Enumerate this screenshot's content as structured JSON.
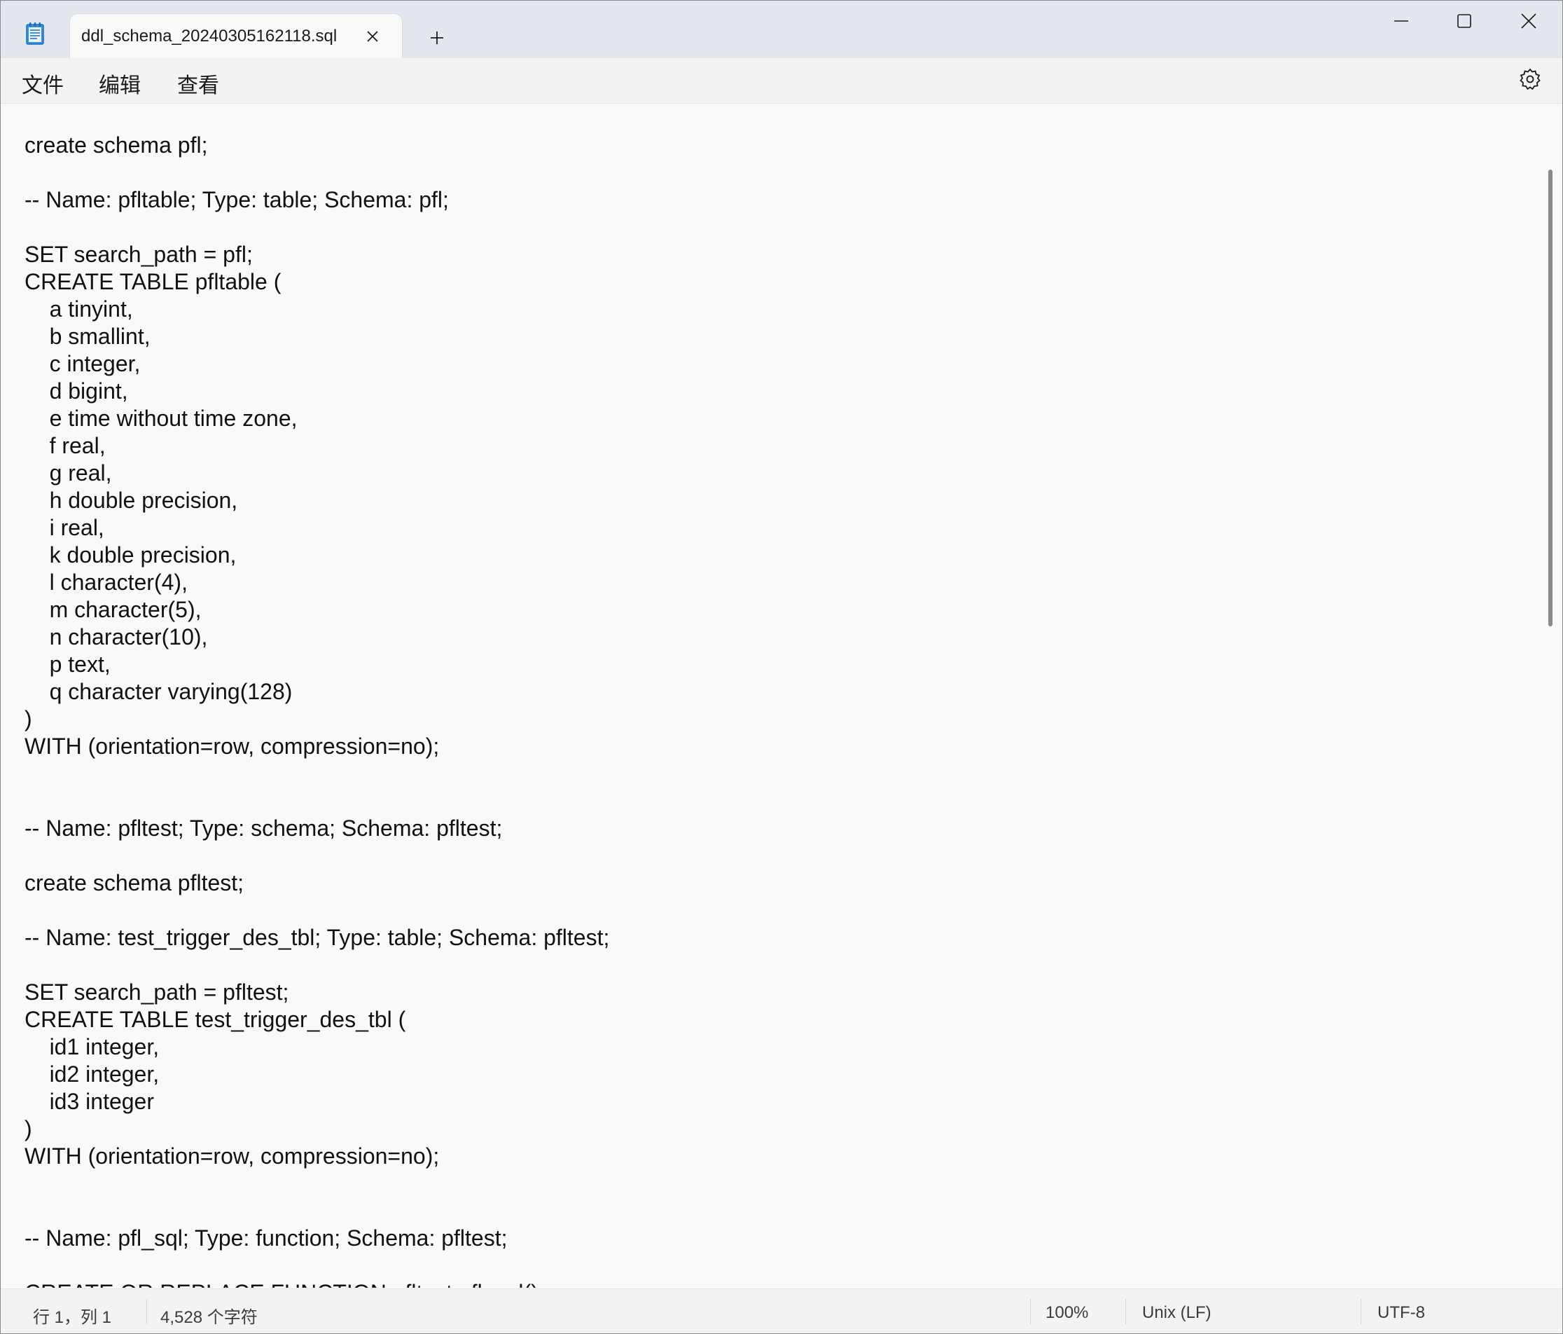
{
  "tab": {
    "title": "ddl_schema_20240305162118.sql"
  },
  "menu": {
    "file": "文件",
    "edit": "编辑",
    "view": "查看"
  },
  "editor": {
    "content": "create schema pfl;\n\n-- Name: pfltable; Type: table; Schema: pfl;\n\nSET search_path = pfl;\nCREATE TABLE pfltable (\n    a tinyint,\n    b smallint,\n    c integer,\n    d bigint,\n    e time without time zone,\n    f real,\n    g real,\n    h double precision,\n    i real,\n    k double precision,\n    l character(4),\n    m character(5),\n    n character(10),\n    p text,\n    q character varying(128)\n)\nWITH (orientation=row, compression=no);\n\n\n-- Name: pfltest; Type: schema; Schema: pfltest;\n\ncreate schema pfltest;\n\n-- Name: test_trigger_des_tbl; Type: table; Schema: pfltest;\n\nSET search_path = pfltest;\nCREATE TABLE test_trigger_des_tbl (\n    id1 integer,\n    id2 integer,\n    id3 integer\n)\nWITH (orientation=row, compression=no);\n\n\n-- Name: pfl_sql; Type: function; Schema: pfltest;\n\nCREATE OR REPLACE FUNCTION pfltest.pfl_sql()"
  },
  "status": {
    "position": "行 1，列 1",
    "char_count": "4,528 个字符",
    "zoom": "100%",
    "line_ending": "Unix (LF)",
    "encoding": "UTF-8"
  },
  "colors": {
    "titlebar": "#e3e8ef",
    "editor_bg": "#f9f9f9",
    "bar_bg": "#f3f3f3",
    "icon_accent": "#1b6ec2"
  },
  "icons": {
    "app": "notepad-icon",
    "tab_close": "close-icon",
    "new_tab": "plus-icon",
    "minimize": "minimize-icon",
    "maximize": "maximize-icon",
    "close": "close-icon",
    "settings": "gear-icon"
  }
}
